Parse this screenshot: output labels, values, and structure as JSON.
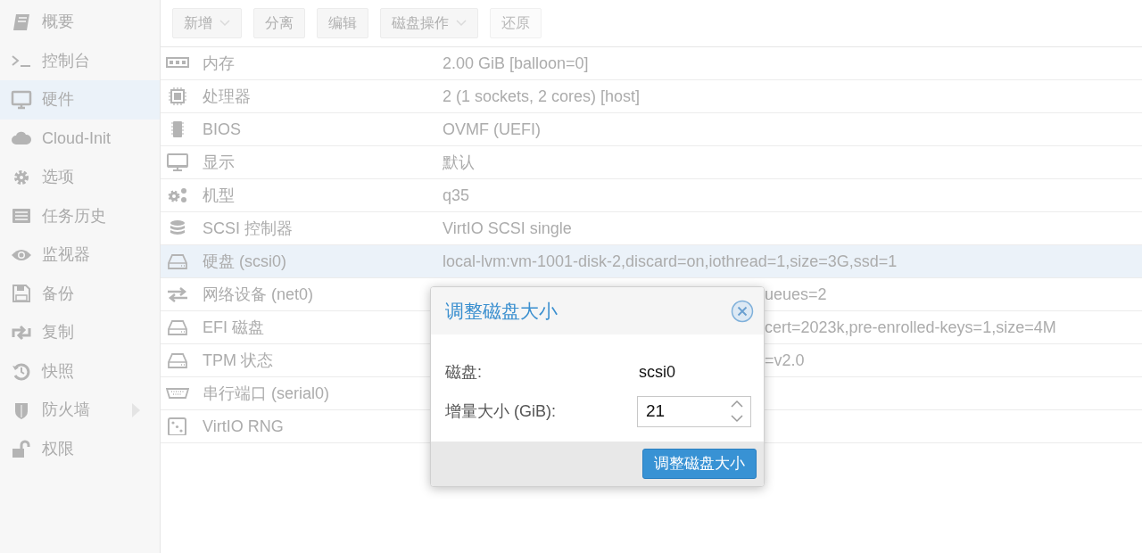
{
  "sidebar": {
    "items": [
      {
        "label": "概要",
        "selected": false,
        "submenu": false
      },
      {
        "label": "控制台",
        "selected": false,
        "submenu": false
      },
      {
        "label": "硬件",
        "selected": true,
        "submenu": false
      },
      {
        "label": "Cloud-Init",
        "selected": false,
        "submenu": false
      },
      {
        "label": "选项",
        "selected": false,
        "submenu": false
      },
      {
        "label": "任务历史",
        "selected": false,
        "submenu": false
      },
      {
        "label": "监视器",
        "selected": false,
        "submenu": false
      },
      {
        "label": "备份",
        "selected": false,
        "submenu": false
      },
      {
        "label": "复制",
        "selected": false,
        "submenu": false
      },
      {
        "label": "快照",
        "selected": false,
        "submenu": false
      },
      {
        "label": "防火墙",
        "selected": false,
        "submenu": true
      },
      {
        "label": "权限",
        "selected": false,
        "submenu": false
      }
    ]
  },
  "toolbar": {
    "buttons": [
      {
        "label": "新增",
        "dropdown": true,
        "disabled": false
      },
      {
        "label": "分离",
        "dropdown": false,
        "disabled": false
      },
      {
        "label": "编辑",
        "dropdown": false,
        "disabled": false
      },
      {
        "label": "磁盘操作",
        "dropdown": true,
        "disabled": false
      },
      {
        "label": "还原",
        "dropdown": false,
        "disabled": true
      }
    ]
  },
  "table": {
    "rows": [
      {
        "name": "内存",
        "value": "2.00 GiB [balloon=0]",
        "selected": false
      },
      {
        "name": "处理器",
        "value": "2 (1 sockets, 2 cores) [host]",
        "selected": false
      },
      {
        "name": "BIOS",
        "value": "OVMF (UEFI)",
        "selected": false
      },
      {
        "name": "显示",
        "value": "默认",
        "selected": false
      },
      {
        "name": "机型",
        "value": "q35",
        "selected": false
      },
      {
        "name": "SCSI 控制器",
        "value": "VirtIO SCSI single",
        "selected": false
      },
      {
        "name": "硬盘 (scsi0)",
        "value": "local-lvm:vm-1001-disk-2,discard=on,iothread=1,size=3G,ssd=1",
        "selected": true
      },
      {
        "name": "网络设备 (net0)",
        "value": "ueues=2",
        "selected": false,
        "covered": true
      },
      {
        "name": "EFI 磁盘",
        "value": "cert=2023k,pre-enrolled-keys=1,size=4M",
        "selected": false,
        "covered": true
      },
      {
        "name": "TPM 状态",
        "value": "=v2.0",
        "selected": false,
        "covered": true
      },
      {
        "name": "串行端口 (serial0)",
        "selected": false
      },
      {
        "name": "VirtIO RNG",
        "selected": false
      }
    ]
  },
  "dialog": {
    "title": "调整磁盘大小",
    "fields": [
      {
        "kind": "text",
        "label": "磁盘:",
        "value": "scsi0"
      },
      {
        "kind": "spinner",
        "label": "增量大小 (GiB):",
        "value": "21"
      }
    ],
    "button": "调整磁盘大小"
  }
}
